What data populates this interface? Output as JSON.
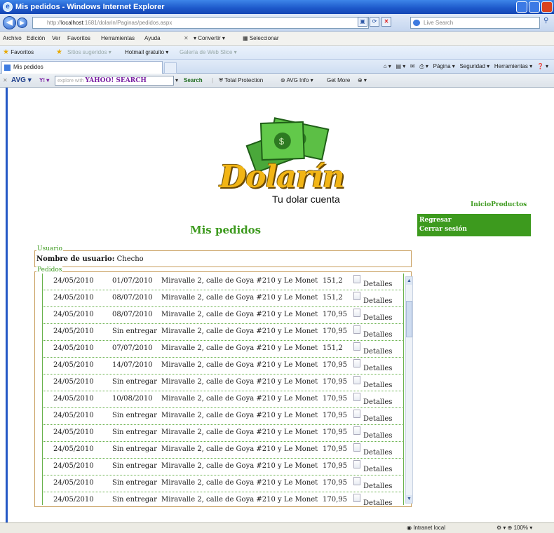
{
  "window": {
    "title": "Mis pedidos - Windows Internet Explorer"
  },
  "address": {
    "prefix": "http://",
    "host": "localhost",
    "rest": ":1681/dolarin/Paginas/pedidos.aspx"
  },
  "livesearch": {
    "placeholder": "Live Search"
  },
  "menu": [
    "Archivo",
    "Edición",
    "Ver",
    "Favoritos",
    "Herramientas",
    "Ayuda"
  ],
  "menu_extra": {
    "convert": "Convertir",
    "select": "Seleccionar"
  },
  "favorites": {
    "label": "Favoritos",
    "suggested": "Sitios sugeridos",
    "hotmail": "Hotmail gratuito",
    "gallery": "Galería de Web Slice"
  },
  "tab": {
    "label": "Mis pedidos"
  },
  "commands": {
    "page": "Página",
    "security": "Seguridad",
    "tools": "Herramientas"
  },
  "avg": {
    "label": "AVG",
    "yahoo_hint": "explore with",
    "yahoo": "YAHOO! SEARCH",
    "search": "Search",
    "protection": "Total Protection",
    "info": "AVG Info",
    "more": "Get More"
  },
  "logo": {
    "word": "Dolarín",
    "tagline": "Tu dolar cuenta"
  },
  "nav": {
    "inicio": "Inicio",
    "productos": "Productos",
    "regresar": "Regresar",
    "cerrar": "Cerrar sesión"
  },
  "page": {
    "title": "Mis pedidos"
  },
  "usuario": {
    "legend": "Usuario",
    "label": "Nombre de usuario:",
    "value": "Checho"
  },
  "pedidos": {
    "legend": "Pedidos",
    "rows": [
      {
        "fecha": "24/05/2010",
        "entrega": "01/07/2010",
        "direccion": "Miravalle 2, calle de Goya #210 y Le Monet",
        "total": "151,2",
        "detalle": "Detalles"
      },
      {
        "fecha": "24/05/2010",
        "entrega": "08/07/2010",
        "direccion": "Miravalle 2, calle de Goya #210 y Le Monet",
        "total": "151,2",
        "detalle": "Detalles"
      },
      {
        "fecha": "24/05/2010",
        "entrega": "08/07/2010",
        "direccion": "Miravalle 2, calle de Goya #210 y Le Monet",
        "total": "170,95",
        "detalle": "Detalles"
      },
      {
        "fecha": "24/05/2010",
        "entrega": "Sin entregar",
        "direccion": "Miravalle 2, calle de Goya #210 y Le Monet",
        "total": "170,95",
        "detalle": "Detalles"
      },
      {
        "fecha": "24/05/2010",
        "entrega": "07/07/2010",
        "direccion": "Miravalle 2, calle de Goya #210 y Le Monet",
        "total": "151,2",
        "detalle": "Detalles"
      },
      {
        "fecha": "24/05/2010",
        "entrega": "14/07/2010",
        "direccion": "Miravalle 2, calle de Goya #210 y Le Monet",
        "total": "170,95",
        "detalle": "Detalles"
      },
      {
        "fecha": "24/05/2010",
        "entrega": "Sin entregar",
        "direccion": "Miravalle 2, calle de Goya #210 y Le Monet",
        "total": "170,95",
        "detalle": "Detalles"
      },
      {
        "fecha": "24/05/2010",
        "entrega": "10/08/2010",
        "direccion": "Miravalle 2, calle de Goya #210 y Le Monet",
        "total": "170,95",
        "detalle": "Detalles"
      },
      {
        "fecha": "24/05/2010",
        "entrega": "Sin entregar",
        "direccion": "Miravalle 2, calle de Goya #210 y Le Monet",
        "total": "170,95",
        "detalle": "Detalles"
      },
      {
        "fecha": "24/05/2010",
        "entrega": "Sin entregar",
        "direccion": "Miravalle 2, calle de Goya #210 y Le Monet",
        "total": "170,95",
        "detalle": "Detalles"
      },
      {
        "fecha": "24/05/2010",
        "entrega": "Sin entregar",
        "direccion": "Miravalle 2, calle de Goya #210 y Le Monet",
        "total": "170,95",
        "detalle": "Detalles"
      },
      {
        "fecha": "24/05/2010",
        "entrega": "Sin entregar",
        "direccion": "Miravalle 2, calle de Goya #210 y Le Monet",
        "total": "170,95",
        "detalle": "Detalles"
      },
      {
        "fecha": "24/05/2010",
        "entrega": "Sin entregar",
        "direccion": "Miravalle 2, calle de Goya #210 y Le Monet",
        "total": "170,95",
        "detalle": "Detalles"
      },
      {
        "fecha": "24/05/2010",
        "entrega": "Sin entregar",
        "direccion": "Miravalle 2, calle de Goya #210 y Le Monet",
        "total": "170,95",
        "detalle": "Detalles"
      }
    ]
  },
  "status": {
    "zone": "Intranet local",
    "zoom": "100%"
  },
  "colors": {
    "accent_green": "#3d9a1e",
    "title_blue": "#1c57c9",
    "logo_gold": "#f2b515"
  },
  "icons": [
    "ie-icon",
    "back-icon",
    "forward-icon",
    "refresh-icon",
    "stop-icon",
    "star-icon",
    "document-icon",
    "scroll-up-icon",
    "scroll-down-icon"
  ]
}
